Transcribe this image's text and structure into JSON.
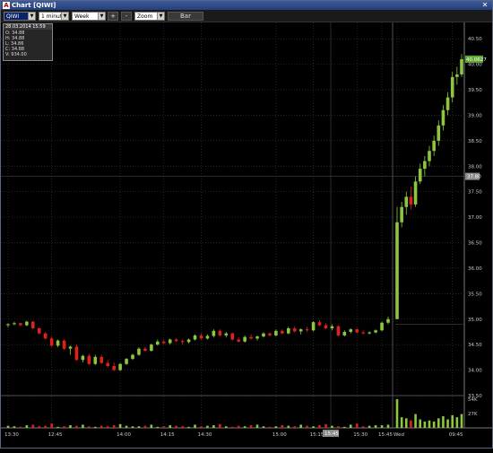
{
  "window": {
    "title": "Chart [QIWI]"
  },
  "toolbar": {
    "symbol": "QIWI",
    "interval": "1 minute",
    "period": "Week",
    "zoom_in_label": "+",
    "zoom_out_label": "-",
    "zoom_label": "Zoom",
    "chart_type_label": "Bar"
  },
  "tooltip": {
    "header": "28.03.2014 15:59",
    "open": "O: 34.88",
    "high": "H: 34.88",
    "low": "L: 34.86",
    "close": "C: 34.88",
    "volume": "V: 934.00"
  },
  "colors": {
    "up": "#8dc63f",
    "down": "#e0211b",
    "grid": "#3c3c3c",
    "axis_text": "#c8c8c8",
    "label_up_bg": "#5fa830",
    "label_gray_bg": "#8a8a8a"
  },
  "chart_data": {
    "type": "candlestick",
    "symbol": "QIWI",
    "interval": "1 minute",
    "ylim": [
      33.5,
      40.75
    ],
    "y_ticks": [
      "33.50",
      "34.00",
      "34.50",
      "35.00",
      "35.50",
      "36.00",
      "36.50",
      "37.00",
      "37.50",
      "38.00",
      "38.50",
      "39.00",
      "39.50",
      "40.00",
      "40.50"
    ],
    "x_ticks": [
      "13:30",
      "12:45",
      "14:00",
      "14:15",
      "14:30",
      "15:00",
      "15:15",
      "15:30",
      "15:45",
      "Wed",
      "09:45"
    ],
    "last_price_label": "40.0627",
    "crosshair_price_label": "37.80",
    "crosshair_time_label": "15:45",
    "volume_ticks": [
      "54K",
      "27K"
    ],
    "volume_max": 54,
    "candles": [
      [
        34.88,
        34.92,
        34.84,
        34.9
      ],
      [
        34.9,
        34.95,
        34.88,
        34.92
      ],
      [
        34.92,
        34.93,
        34.86,
        34.88
      ],
      [
        34.88,
        34.97,
        34.86,
        34.95
      ],
      [
        34.95,
        34.97,
        34.8,
        34.82
      ],
      [
        34.82,
        34.84,
        34.7,
        34.72
      ],
      [
        34.72,
        34.75,
        34.6,
        34.62
      ],
      [
        34.62,
        34.66,
        34.46,
        34.48
      ],
      [
        34.48,
        34.6,
        34.45,
        34.58
      ],
      [
        34.58,
        34.6,
        34.4,
        34.42
      ],
      [
        34.42,
        34.48,
        34.3,
        34.46
      ],
      [
        34.46,
        34.5,
        34.18,
        34.2
      ],
      [
        34.2,
        34.3,
        34.15,
        34.28
      ],
      [
        34.28,
        34.32,
        34.1,
        34.12
      ],
      [
        34.12,
        34.3,
        34.1,
        34.26
      ],
      [
        34.26,
        34.3,
        34.12,
        34.14
      ],
      [
        34.14,
        34.2,
        34.05,
        34.08
      ],
      [
        34.08,
        34.15,
        33.98,
        34.0
      ],
      [
        34.0,
        34.14,
        33.98,
        34.12
      ],
      [
        34.12,
        34.24,
        34.1,
        34.22
      ],
      [
        34.22,
        34.32,
        34.2,
        34.3
      ],
      [
        34.3,
        34.45,
        34.28,
        34.42
      ],
      [
        34.42,
        34.46,
        34.36,
        34.38
      ],
      [
        34.38,
        34.52,
        34.36,
        34.5
      ],
      [
        34.5,
        34.6,
        34.48,
        34.56
      ],
      [
        34.56,
        34.6,
        34.5,
        34.53
      ],
      [
        34.53,
        34.62,
        34.5,
        34.6
      ],
      [
        34.6,
        34.63,
        34.55,
        34.57
      ],
      [
        34.57,
        34.6,
        34.5,
        34.55
      ],
      [
        34.55,
        34.62,
        34.52,
        34.6
      ],
      [
        34.6,
        34.7,
        34.58,
        34.68
      ],
      [
        34.68,
        34.72,
        34.6,
        34.62
      ],
      [
        34.62,
        34.7,
        34.6,
        34.67
      ],
      [
        34.67,
        34.8,
        34.64,
        34.77
      ],
      [
        34.77,
        34.8,
        34.66,
        34.68
      ],
      [
        34.68,
        34.75,
        34.64,
        34.72
      ],
      [
        34.72,
        34.74,
        34.58,
        34.6
      ],
      [
        34.6,
        34.64,
        34.54,
        34.56
      ],
      [
        34.56,
        34.68,
        34.54,
        34.65
      ],
      [
        34.65,
        34.7,
        34.6,
        34.62
      ],
      [
        34.62,
        34.68,
        34.58,
        34.66
      ],
      [
        34.66,
        34.74,
        34.64,
        34.72
      ],
      [
        34.72,
        34.74,
        34.66,
        34.68
      ],
      [
        34.68,
        34.8,
        34.66,
        34.77
      ],
      [
        34.77,
        34.8,
        34.7,
        34.72
      ],
      [
        34.72,
        34.85,
        34.7,
        34.82
      ],
      [
        34.82,
        34.86,
        34.74,
        34.76
      ],
      [
        34.76,
        34.82,
        34.7,
        34.8
      ],
      [
        34.8,
        34.85,
        34.75,
        34.78
      ],
      [
        34.78,
        34.96,
        34.76,
        34.94
      ],
      [
        34.94,
        34.98,
        34.86,
        34.88
      ],
      [
        34.88,
        34.92,
        34.8,
        34.82
      ],
      [
        34.82,
        34.9,
        34.78,
        34.86
      ],
      [
        34.86,
        34.88,
        34.66,
        34.68
      ],
      [
        34.68,
        34.78,
        34.66,
        34.75
      ],
      [
        34.75,
        34.82,
        34.72,
        34.8
      ],
      [
        34.8,
        34.82,
        34.72,
        34.74
      ],
      [
        34.74,
        34.78,
        34.7,
        34.72
      ],
      [
        34.72,
        34.76,
        34.7,
        34.74
      ],
      [
        34.74,
        34.8,
        34.72,
        34.78
      ],
      [
        34.78,
        34.95,
        34.76,
        34.93
      ],
      [
        34.93,
        35.05,
        34.9,
        35.0
      ],
      [
        35.0,
        37.2,
        36.1,
        36.9
      ],
      [
        36.9,
        37.3,
        36.8,
        37.2
      ],
      [
        37.2,
        37.5,
        37.05,
        37.4
      ],
      [
        37.4,
        37.6,
        37.15,
        37.25
      ],
      [
        37.25,
        37.8,
        37.2,
        37.7
      ],
      [
        37.7,
        38.05,
        37.65,
        37.95
      ],
      [
        37.95,
        38.2,
        37.8,
        38.1
      ],
      [
        38.1,
        38.4,
        38.0,
        38.3
      ],
      [
        38.3,
        38.6,
        38.2,
        38.5
      ],
      [
        38.5,
        38.9,
        38.4,
        38.8
      ],
      [
        38.8,
        39.2,
        38.7,
        39.1
      ],
      [
        39.1,
        39.45,
        39.0,
        39.35
      ],
      [
        39.35,
        39.85,
        39.25,
        39.75
      ],
      [
        39.75,
        39.95,
        39.6,
        39.8
      ],
      [
        39.8,
        40.2,
        39.75,
        40.1
      ]
    ],
    "volumes": [
      4,
      3,
      2,
      5,
      6,
      3,
      4,
      8,
      2,
      3,
      5,
      4,
      6,
      3,
      2,
      4,
      3,
      5,
      7,
      4,
      3,
      3,
      4,
      6,
      2,
      3,
      5,
      4,
      3,
      2,
      6,
      3,
      4,
      5,
      7,
      3,
      2,
      4,
      3,
      5,
      6,
      3,
      2,
      3,
      5,
      4,
      3,
      6,
      4,
      3,
      5,
      7,
      4,
      3,
      2,
      6,
      8,
      3,
      4,
      5,
      5,
      6,
      54,
      20,
      18,
      14,
      26,
      16,
      12,
      14,
      12,
      18,
      22,
      16,
      24,
      20,
      26
    ]
  }
}
